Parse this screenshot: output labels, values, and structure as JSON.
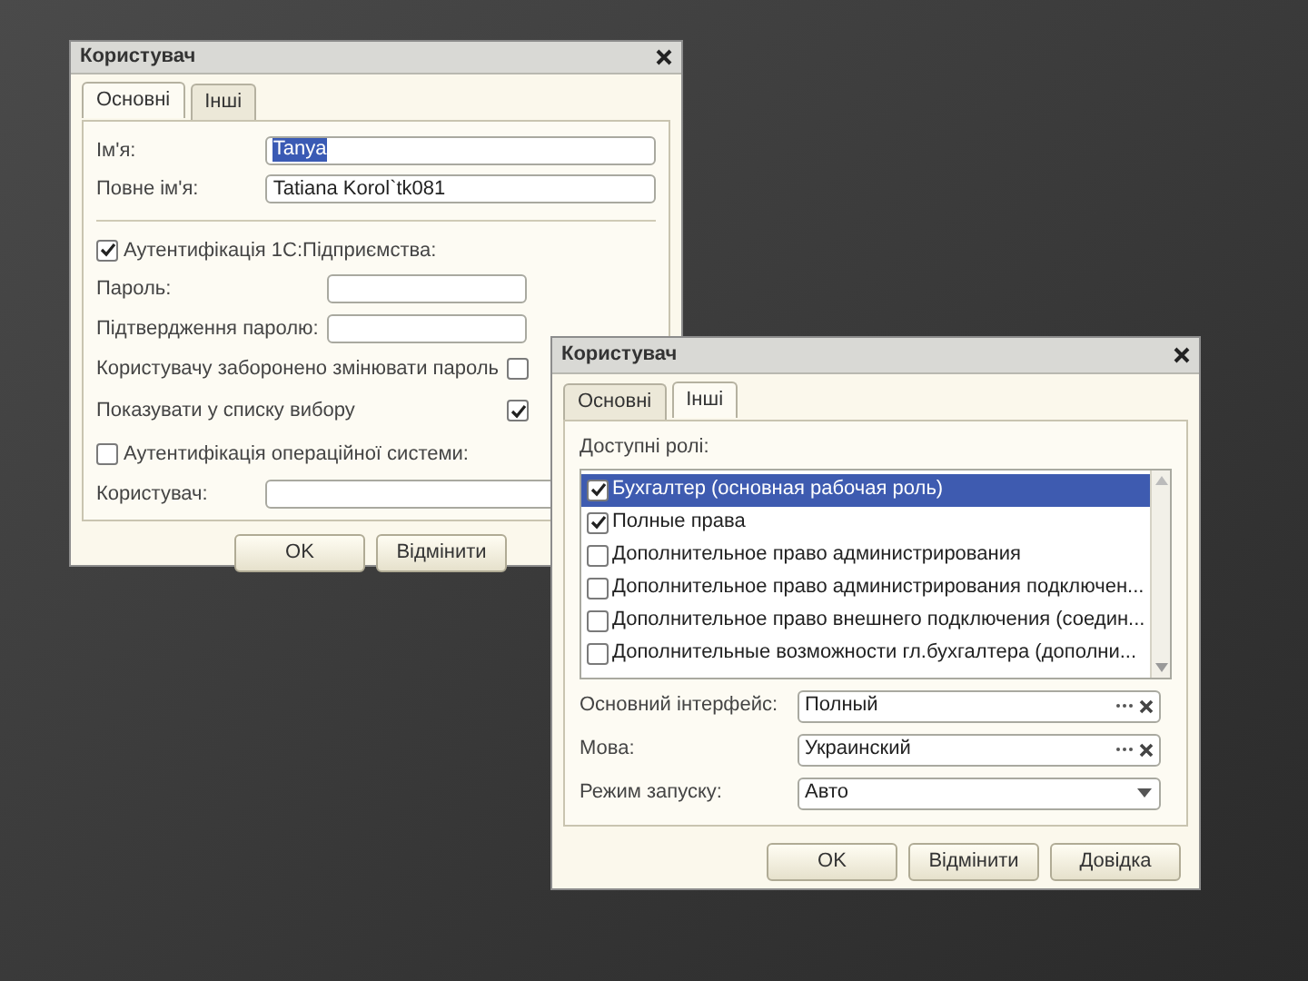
{
  "windows": [
    {
      "title": "Користувач",
      "tabs": [
        {
          "label": "Основні",
          "selected": true
        },
        {
          "label": "Інші",
          "selected": false
        }
      ],
      "name_field": {
        "label": "Ім'я:",
        "value": "Tanya",
        "selected": true
      },
      "full_name_field": {
        "label": "Повне ім'я:",
        "value": "Tatiana Korol`tk081"
      },
      "auth_1c": {
        "label": "Аутентифікація 1С:Підприємства:",
        "checked": true
      },
      "password": {
        "label": "Пароль:"
      },
      "password_confirm": {
        "label": "Підтвердження паролю:"
      },
      "options": [
        {
          "label": "Користувачу заборонено змінювати пароль",
          "checked": false
        },
        {
          "label": "Показувати у списку вибору",
          "checked": true
        }
      ],
      "os_auth": {
        "label": "Аутентифікація операційної системи:",
        "checked": false
      },
      "os_user": {
        "label": "Користувач:"
      },
      "buttons": [
        "OK",
        "Відмінити"
      ]
    },
    {
      "title": "Користувач",
      "tabs": [
        {
          "label": "Основні",
          "selected": false
        },
        {
          "label": "Інші",
          "selected": true
        }
      ],
      "roles_label": "Доступні ролі:",
      "roles": [
        {
          "label": "Бухгалтер (основная рабочая роль)",
          "checked": true,
          "selected": true
        },
        {
          "label": "Полные права",
          "checked": true,
          "selected": false
        },
        {
          "label": "Дополнительное право администрирования",
          "checked": false,
          "selected": false
        },
        {
          "label": "Дополнительное право администрирования подключен...",
          "checked": false,
          "selected": false
        },
        {
          "label": "Дополнительное право внешнего подключения (соедин...",
          "checked": false,
          "selected": false
        },
        {
          "label": "Дополнительные возможности гл.бухгалтера (дополни...",
          "checked": false,
          "selected": false
        }
      ],
      "fields": [
        {
          "kind": "choice",
          "label": "Основний інтерфейс:",
          "value": "Полный"
        },
        {
          "kind": "choice",
          "label": "Мова:",
          "value": "Украинский"
        },
        {
          "kind": "dropdown",
          "label": "Режим запуску:",
          "value": "Авто"
        }
      ],
      "buttons": [
        "OK",
        "Відмінити",
        "Довідка"
      ]
    }
  ]
}
